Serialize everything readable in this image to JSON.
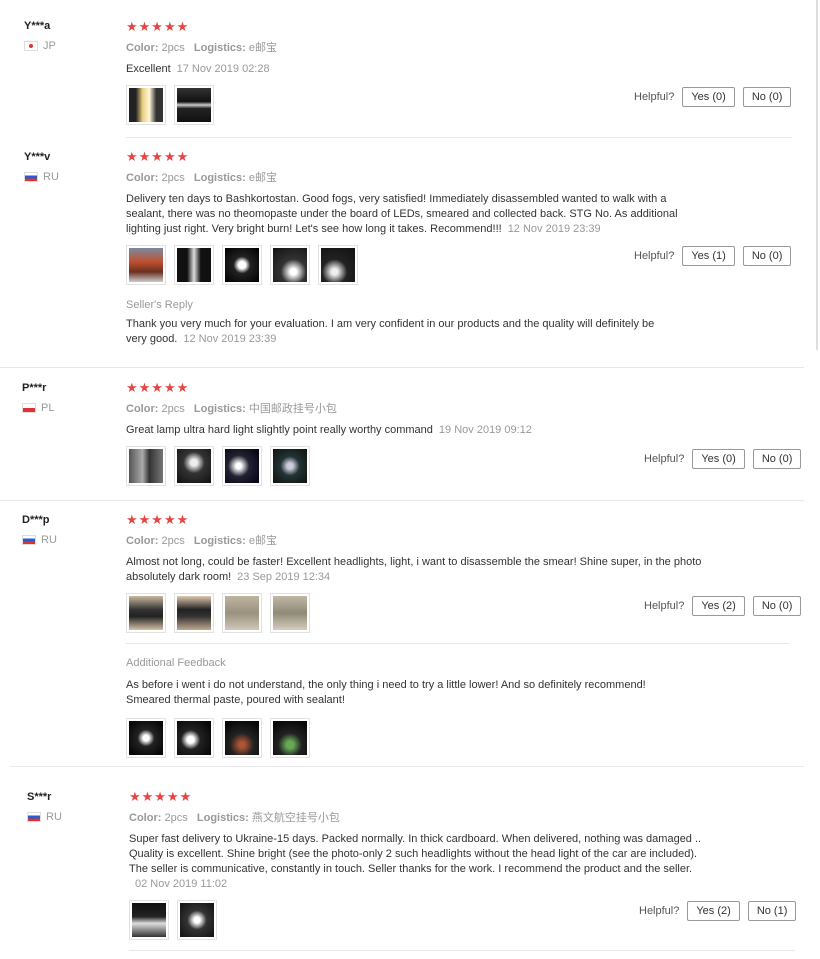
{
  "labels": {
    "color": "Color:",
    "logistics": "Logistics:",
    "helpful": "Helpful?"
  },
  "reviews": [
    {
      "user": "Y***a",
      "country": "JP",
      "stars": "★★★★★",
      "color": "2pcs",
      "logistics": "e邮宝",
      "text": "Excellent",
      "date": "17 Nov 2019 02:28",
      "yes": "Yes (0)",
      "no": "No (0)"
    },
    {
      "user": "Y***v",
      "country": "RU",
      "stars": "★★★★★",
      "color": "2pcs",
      "logistics": "e邮宝",
      "text": "Delivery ten days to Bashkortostan. Good fogs, very satisfied! Immediately disassembled wanted to walk with a sealant, there was no theomopaste under the board of LEDs, smeared and collected back. STG No. As additional lighting just right. Very bright burn! Let's see how long it takes. Recommend!!!",
      "date": "12 Nov 2019 23:39",
      "yes": "Yes (1)",
      "no": "No (0)",
      "reply_title": "Seller's Reply",
      "reply_text": "Thank you very much for your evaluation. I am very confident in our products and the quality will definitely be very good.",
      "reply_date": "12 Nov 2019 23:39"
    },
    {
      "user": "P***r",
      "country": "PL",
      "stars": "★★★★★",
      "color": "2pcs",
      "logistics": "中国邮政挂号小包",
      "text": "Great lamp ultra hard light slightly point really worthy command",
      "date": "19 Nov 2019 09:12",
      "yes": "Yes (0)",
      "no": "No (0)"
    },
    {
      "user": "D***p",
      "country": "RU",
      "stars": "★★★★★",
      "color": "2pcs",
      "logistics": "e邮宝",
      "text": "Almost not long, could be faster! Excellent headlights, light, i want to disassemble the smear! Shine super, in the photo absolutely dark room!",
      "date": "23 Sep 2019 12:34",
      "yes": "Yes (2)",
      "no": "No (0)",
      "additional_title": "Additional Feedback",
      "additional_text": "As before i went i do not understand, the only thing i need to try a little lower! And so definitely recommend! Smeared thermal paste, poured with sealant!"
    },
    {
      "user": "S***r",
      "country": "RU",
      "stars": "★★★★★",
      "color": "2pcs",
      "logistics": "燕文航空挂号小包",
      "text": "Super fast delivery to Ukraine-15 days. Packed normally. In thick cardboard. When delivered, nothing was damaged .. Quality is excellent. Shine bright (see the photo-only 2 such headlights without the head light of the car are included). The seller is communicative, constantly in touch. Seller thanks for the work. I recommend the product and the seller.",
      "date": "02 Nov 2019 11:02",
      "yes": "Yes (2)",
      "no": "No (1)"
    }
  ],
  "colors": {
    "stars": "#e64545",
    "muted": "#999999",
    "border": "#e8e8e8"
  }
}
